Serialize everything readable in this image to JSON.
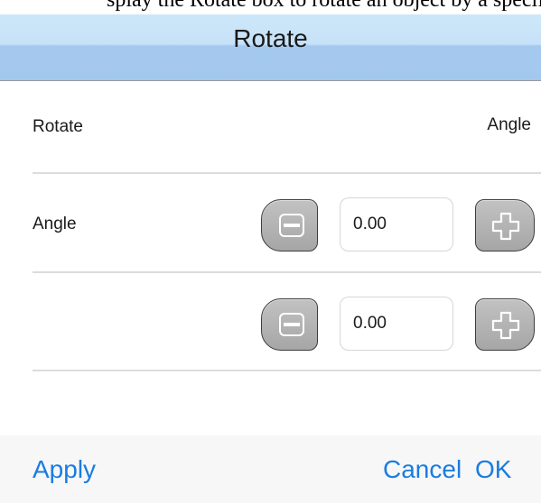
{
  "window": {
    "top_strip_text": "splay the Rotate box to rotate an object by a specified angle. Adjus"
  },
  "dialog": {
    "title": "Rotate"
  },
  "header_row": {
    "left_label": "Rotate",
    "right_label": "Angle"
  },
  "angle_row": {
    "label": "Angle",
    "value": "0.00"
  },
  "second_row": {
    "label": "",
    "value": "0.00"
  },
  "toolbar": {
    "apply_label": "Apply",
    "cancel_label": "Cancel",
    "ok_label": "OK"
  },
  "icons": {
    "decrement": "minus-icon",
    "increment": "plus-icon"
  },
  "colors": {
    "title_bar_light": "#cde7f9",
    "title_bar_dark": "#a3c8ee",
    "action_blue": "#1a7ce0",
    "toolbar_bg": "#f7f7f7",
    "stepper_gray": "#a6a6a6"
  }
}
